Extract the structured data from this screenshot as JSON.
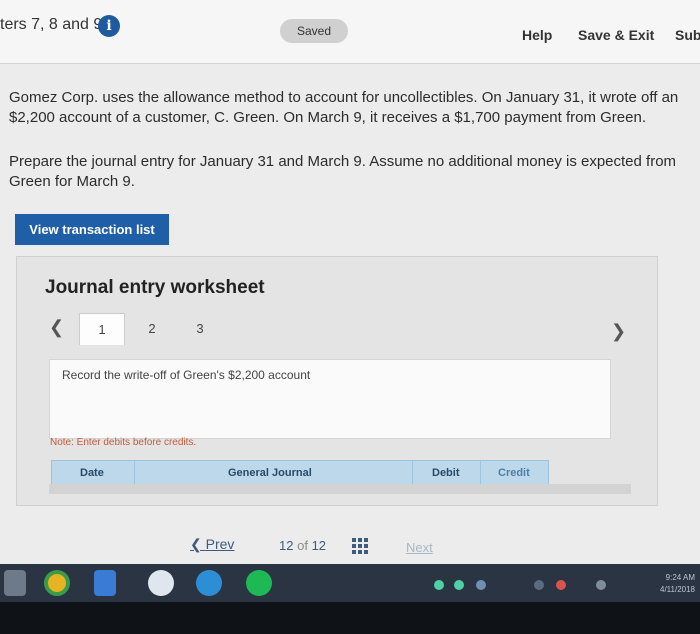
{
  "header": {
    "chapters_label": "ters 7, 8 and 9",
    "info_glyph": "i",
    "saved_label": "Saved",
    "help_label": "Help",
    "save_exit_label": "Save & Exit",
    "submit_label": "Sub"
  },
  "question": {
    "line1": "Gomez Corp. uses the allowance method to account for uncollectibles. On January 31, it wrote off an",
    "line2": "$2,200 account of a customer, C. Green. On March 9, it receives a $1,700 payment from Green.",
    "line3": "Prepare the journal entry for January 31 and March 9. Assume no additional money is expected from",
    "line4": "Green for March 9."
  },
  "view_transactions_label": "View transaction list",
  "worksheet": {
    "title": "Journal entry worksheet",
    "tabs": [
      "1",
      "2",
      "3"
    ],
    "active_tab": "1",
    "record_instruction": "Record the write-off of Green's $2,200 account",
    "note": "Note: Enter debits before credits.",
    "columns": {
      "date": "Date",
      "general_journal": "General Journal",
      "debit": "Debit",
      "credit": "Credit"
    }
  },
  "pagination": {
    "prev_label": "Prev",
    "current": "12",
    "of_label": "of",
    "total": "12",
    "next_label": "Next"
  },
  "taskbar": {
    "time": "9:24 AM",
    "date": "4/11/2018"
  },
  "colors": {
    "primary_blue": "#1f5fa8",
    "table_header": "#bcd8ea",
    "note_text": "#c45a3a"
  }
}
